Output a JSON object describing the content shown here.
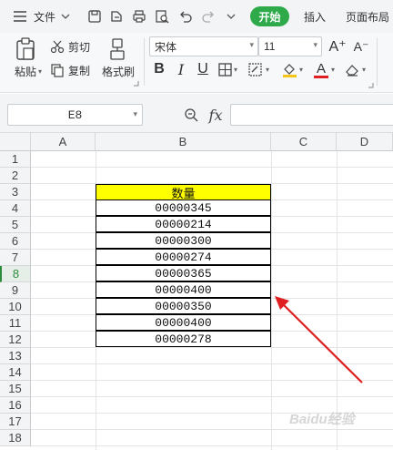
{
  "menubar": {
    "file_label": "文件",
    "tab_start": "开始",
    "tab_insert": "插入",
    "tab_page_layout": "页面布局"
  },
  "ribbon": {
    "paste_label": "粘贴",
    "cut_label": "剪切",
    "copy_label": "复制",
    "format_painter_label": "格式刷",
    "font_name": "宋体",
    "font_size": "11",
    "bold": "B",
    "italic": "I",
    "underline": "U",
    "increase_font": "A⁺",
    "decrease_font": "A⁻",
    "font_color_glyph": "A",
    "colors": {
      "highlight": "#f5c518",
      "font_color": "#e02020",
      "accent": "#2eaa4a"
    }
  },
  "formula_bar": {
    "name_box": "E8",
    "fx_label": "fx",
    "content": ""
  },
  "sheet": {
    "columns": [
      "A",
      "B",
      "C",
      "D"
    ],
    "rows": [
      "1",
      "2",
      "3",
      "4",
      "5",
      "6",
      "7",
      "8",
      "9",
      "10",
      "11",
      "12",
      "13",
      "14",
      "15",
      "16",
      "17",
      "18"
    ],
    "selected_row": "8",
    "table_header": "数量",
    "table_header_color": "#ffff00",
    "values": [
      "00000345",
      "00000214",
      "00000300",
      "00000274",
      "00000365",
      "00000400",
      "00000350",
      "00000400",
      "00000278"
    ]
  },
  "annotation": {
    "arrow_color": "#e02020"
  },
  "watermark": "Baidu经验"
}
